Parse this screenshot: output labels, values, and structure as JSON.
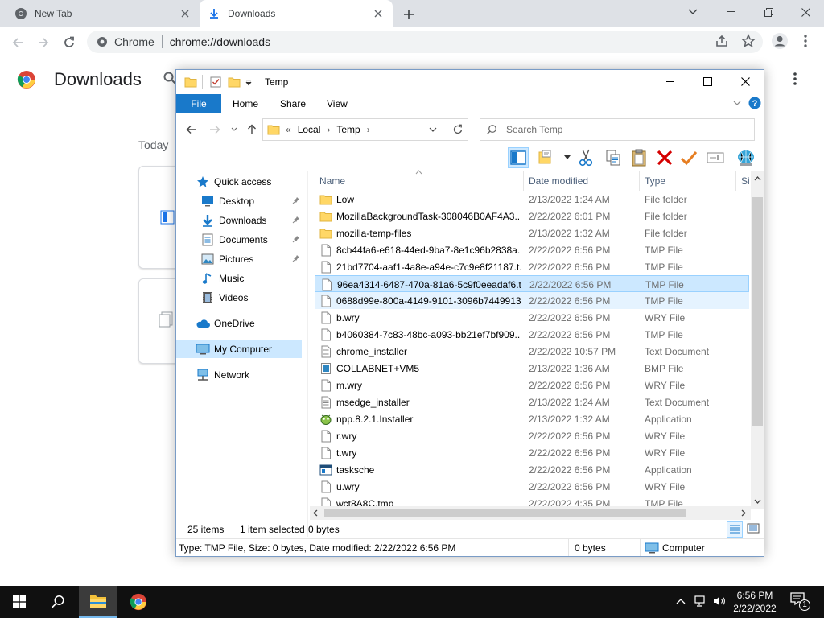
{
  "browser": {
    "tabs": [
      {
        "title": "New Tab"
      },
      {
        "title": "Downloads"
      }
    ],
    "omnibox": {
      "site_label": "Chrome",
      "url": "chrome://downloads"
    }
  },
  "downloads_page": {
    "title": "Downloads",
    "section_label": "Today"
  },
  "explorer": {
    "title": "Temp",
    "ribbon_tabs": [
      "File",
      "Home",
      "Share",
      "View"
    ],
    "breadcrumb": [
      "«",
      "Local",
      "›",
      "Temp",
      "›"
    ],
    "search_placeholder": "Search Temp",
    "nav_pane": [
      {
        "label": "Quick access",
        "icon": "star-icon"
      },
      {
        "label": "Desktop",
        "icon": "desktop-icon",
        "pinned": true
      },
      {
        "label": "Downloads",
        "icon": "download-arrow-icon",
        "pinned": true
      },
      {
        "label": "Documents",
        "icon": "documents-icon",
        "pinned": true
      },
      {
        "label": "Pictures",
        "icon": "pictures-icon",
        "pinned": true
      },
      {
        "label": "Music",
        "icon": "music-icon"
      },
      {
        "label": "Videos",
        "icon": "videos-icon"
      },
      {
        "label": "OneDrive",
        "icon": "cloud-icon"
      },
      {
        "label": "My Computer",
        "icon": "computer-icon",
        "selected": true
      },
      {
        "label": "Network",
        "icon": "network-icon"
      }
    ],
    "columns": {
      "name": "Name",
      "date": "Date modified",
      "type": "Type",
      "size": "Si"
    },
    "files": [
      {
        "name": "Low",
        "date": "2/13/2022 1:24 AM",
        "type": "File folder",
        "icon": "folder"
      },
      {
        "name": "MozillaBackgroundTask-308046B0AF4A3...",
        "date": "2/22/2022 6:01 PM",
        "type": "File folder",
        "icon": "folder"
      },
      {
        "name": "mozilla-temp-files",
        "date": "2/13/2022 1:32 AM",
        "type": "File folder",
        "icon": "folder"
      },
      {
        "name": "8cb44fa6-e618-44ed-9ba7-8e1c96b2838a....",
        "date": "2/22/2022 6:56 PM",
        "type": "TMP File",
        "icon": "file"
      },
      {
        "name": "21bd7704-aaf1-4a8e-a94e-c7c9e8f21187.t...",
        "date": "2/22/2022 6:56 PM",
        "type": "TMP File",
        "icon": "file"
      },
      {
        "name": "96ea4314-6487-470a-81a6-5c9f0eeadaf6.t...",
        "date": "2/22/2022 6:56 PM",
        "type": "TMP File",
        "icon": "file",
        "state": "selected"
      },
      {
        "name": "0688d99e-800a-4149-9101-3096b7449913....",
        "date": "2/22/2022 6:56 PM",
        "type": "TMP File",
        "icon": "file",
        "state": "hover"
      },
      {
        "name": "b.wry",
        "date": "2/22/2022 6:56 PM",
        "type": "WRY File",
        "icon": "file"
      },
      {
        "name": "b4060384-7c83-48bc-a093-bb21ef7bf909....",
        "date": "2/22/2022 6:56 PM",
        "type": "TMP File",
        "icon": "file"
      },
      {
        "name": "chrome_installer",
        "date": "2/22/2022 10:57 PM",
        "type": "Text Document",
        "icon": "text"
      },
      {
        "name": "COLLABNET+VM5",
        "date": "2/13/2022 1:36 AM",
        "type": "BMP File",
        "icon": "bmp"
      },
      {
        "name": "m.wry",
        "date": "2/22/2022 6:56 PM",
        "type": "WRY File",
        "icon": "file"
      },
      {
        "name": "msedge_installer",
        "date": "2/13/2022 1:24 AM",
        "type": "Text Document",
        "icon": "text"
      },
      {
        "name": "npp.8.2.1.Installer",
        "date": "2/13/2022 1:32 AM",
        "type": "Application",
        "icon": "npp"
      },
      {
        "name": "r.wry",
        "date": "2/22/2022 6:56 PM",
        "type": "WRY File",
        "icon": "file"
      },
      {
        "name": "t.wry",
        "date": "2/22/2022 6:56 PM",
        "type": "WRY File",
        "icon": "file"
      },
      {
        "name": "tasksche",
        "date": "2/22/2022 6:56 PM",
        "type": "Application",
        "icon": "app"
      },
      {
        "name": "u.wry",
        "date": "2/22/2022 6:56 PM",
        "type": "WRY File",
        "icon": "file"
      },
      {
        "name": "wct8A8C.tmp",
        "date": "2/22/2022 4:35 PM",
        "type": "TMP File",
        "icon": "file"
      }
    ],
    "status": {
      "item_count": "25 items",
      "selection": "1 item selected",
      "size": "0 bytes"
    },
    "details": {
      "info": "Type: TMP File, Size: 0 bytes, Date modified: 2/22/2022 6:56 PM",
      "size": "0 bytes",
      "location": "Computer"
    }
  },
  "taskbar": {
    "time": "6:56 PM",
    "date": "2/22/2022",
    "notification_count": "1"
  }
}
